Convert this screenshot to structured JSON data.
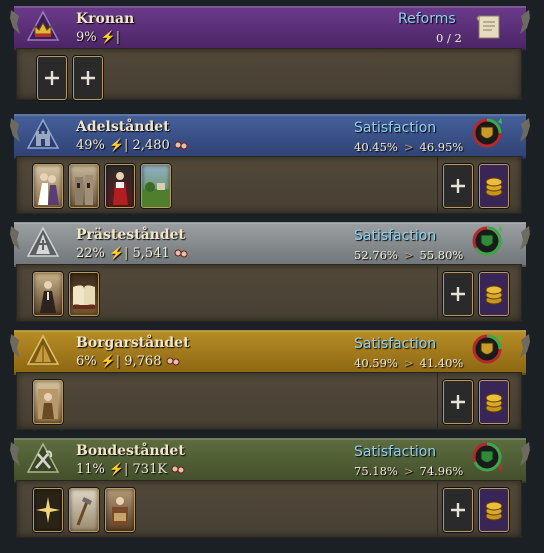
{
  "crown": {
    "name": "Kronan",
    "power": "9%",
    "reforms_label": "Reforms",
    "reforms_count": "0 / 2",
    "band_color": "#5b2f78"
  },
  "estates": [
    {
      "name": "Adelståndet",
      "power": "49%",
      "population": "2,480",
      "satisfaction_label": "Satisfaction",
      "satisfaction_current": "40.45%",
      "satisfaction_target": "46.95%",
      "trend": "up",
      "band_color": "#3a4f85",
      "privilege_icons": [
        "noble-couple-icon",
        "castle-icon",
        "royal-portrait-icon",
        "landscape-icon"
      ]
    },
    {
      "name": "Prästeståndet",
      "power": "22%",
      "population": "5,541",
      "satisfaction_label": "Satisfaction",
      "satisfaction_current": "52.76%",
      "satisfaction_target": "55.80%",
      "trend": "up",
      "band_color": "#8a8d8e",
      "privilege_icons": [
        "priest-icon",
        "book-icon"
      ]
    },
    {
      "name": "Borgarståndet",
      "power": "6%",
      "population": "9,768",
      "satisfaction_label": "Satisfaction",
      "satisfaction_current": "40.59%",
      "satisfaction_target": "41.40%",
      "trend": "up",
      "band_color": "#a67d1c",
      "privilege_icons": [
        "merchant-icon"
      ]
    },
    {
      "name": "Bondeståndet",
      "power": "11%",
      "population": "731K",
      "satisfaction_label": "Satisfaction",
      "satisfaction_current": "75.18%",
      "satisfaction_target": "74.96%",
      "trend": "down",
      "band_color": "#54623a",
      "privilege_icons": [
        "star-icon",
        "tools-icon",
        "farmer-icon"
      ]
    }
  ]
}
